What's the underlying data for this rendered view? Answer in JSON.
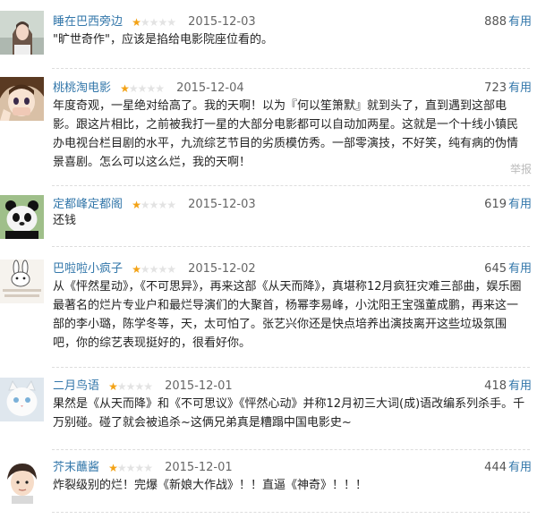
{
  "useful_label": "有用",
  "report_label": "举报",
  "colors": {
    "link": "#3377aa",
    "star_on": "#f3a215",
    "star_off": "#e3e3e3"
  },
  "reviews": [
    {
      "user": "睡在巴西旁边",
      "avatar": "girl-photo-avatar",
      "rating": 1,
      "date": "2015-12-03",
      "votes": "888",
      "text": "\"旷世奇作\"，应该是掐给电影院座位看的。"
    },
    {
      "user": "桃桃淘电影",
      "avatar": "anime-girl-avatar",
      "rating": 1,
      "date": "2015-12-04",
      "votes": "723",
      "text": "年度奇观，一星绝对给高了。我的天啊！以为『何以笙箫默』就到头了，直到遇到这部电影。跟这片相比，之前被我打一星的大部分电影都可以自动加两星。这就是一个十线小镇民办电视台栏目剧的水平，九流综艺节目的劣质模仿秀。一部零演技，不好笑，纯有病的伪情景喜剧。怎么可以这么烂，我的天啊！"
    },
    {
      "user": "定都峰定都阁",
      "avatar": "panda-avatar",
      "rating": 1,
      "date": "2015-12-03",
      "votes": "619",
      "text": "还钱"
    },
    {
      "user": "巴啦啦小疯子",
      "avatar": "rabbit-sticker-avatar",
      "rating": 1,
      "date": "2015-12-02",
      "votes": "645",
      "text": "从《怦然星动》，《不可思异》，再来这部《从天而降》，真堪称12月疯狂灾难三部曲，娱乐圈最著名的烂片专业户和最烂导演们的大聚首，杨幂李易峰，小沈阳王宝强董成鹏，再来这一部的李小璐，陈学冬等，天，太可怕了。张艺兴你还是快点培养出演技离开这些垃圾氛围吧，你的综艺表现挺好的，很看好你。"
    },
    {
      "user": "二月鸟语",
      "avatar": "white-cat-avatar",
      "rating": 1,
      "date": "2015-12-01",
      "votes": "418",
      "text": "果然是《从天而降》和《不可思议》《怦然心动》并称12月初三大词(成)语改编系列杀手。千万别碰。碰了就会被追杀~这俩兄弟真是糟蹋中国电影史~"
    },
    {
      "user": "芥末蘸酱",
      "avatar": "cartoon-boy-avatar",
      "rating": 1,
      "date": "2015-12-01",
      "votes": "444",
      "text": "炸裂级别的烂！完爆《新娘大作战》！！直逼《神奇》！！！"
    }
  ]
}
